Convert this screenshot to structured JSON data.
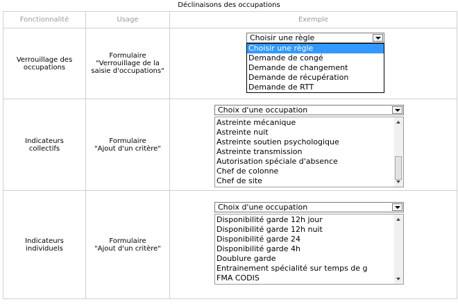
{
  "title": "Déclinaisons des occupations",
  "headers": {
    "col1": "Fonctionnalité",
    "col2": "Usage",
    "col3": "Exemple"
  },
  "rows": [
    {
      "feature": "Verrouillage des occupations",
      "usage_line1": "Formulaire",
      "usage_line2": "\"Verrouillage de la saisie d'occupations\"",
      "select_value": "Choisir une règle",
      "options": [
        "Choisir une règle",
        "Demande de congé",
        "Demande de changement",
        "Demande de récupération",
        "Demande de RTT"
      ]
    },
    {
      "feature": "Indicateurs collectifs",
      "usage_line1": "Formulaire",
      "usage_line2": "\"Ajout d'un critère\"",
      "select_value": "Choix d'une occupation",
      "options": [
        "Astreinte mécanique",
        "Astreinte nuit",
        "Astreinte soutien psychologique",
        "Astreinte transmission",
        "Autorisation spéciale d'absence",
        "Chef de colonne",
        "Chef de site"
      ]
    },
    {
      "feature": "Indicateurs individuels",
      "usage_line1": "Formulaire",
      "usage_line2": "\"Ajout d'un critère\"",
      "select_value": "Choix d'une occupation",
      "options": [
        "Disponibilité garde 12h jour",
        "Disponibilité garde 12h nuit",
        "Disponibilité garde 24",
        "Disponibilité garde 4h",
        "Doublure garde",
        "Entrainement spécialité sur temps de g",
        "FMA CODIS"
      ]
    }
  ],
  "colors": {
    "border": "#cfcfcf",
    "header_text": "#9a9a9a",
    "highlight": "#3399ff"
  }
}
